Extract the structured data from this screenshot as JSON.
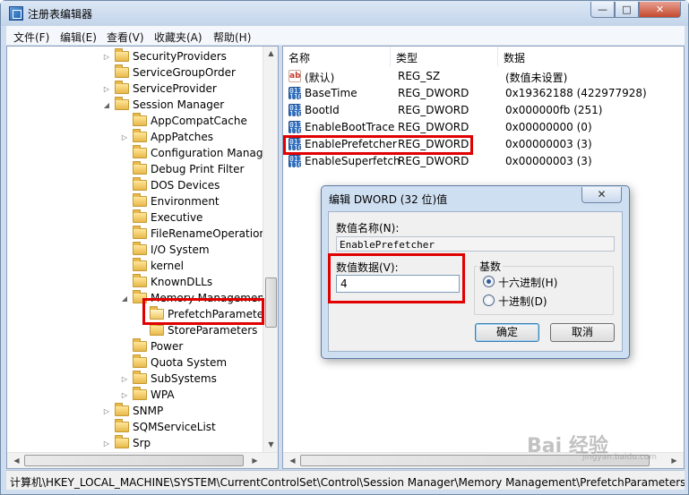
{
  "window": {
    "title": "注册表编辑器"
  },
  "window_buttons": {
    "min": "—",
    "max": "□",
    "close": "✕"
  },
  "menu": [
    "文件(F)",
    "编辑(E)",
    "查看(V)",
    "收藏夹(A)",
    "帮助(H)"
  ],
  "tree": [
    {
      "label": "SecurityProviders",
      "level": 1,
      "expander": "▷"
    },
    {
      "label": "ServiceGroupOrder",
      "level": 1,
      "expander": ""
    },
    {
      "label": "ServiceProvider",
      "level": 1,
      "expander": "▷"
    },
    {
      "label": "Session Manager",
      "level": 1,
      "expander": "◢"
    },
    {
      "label": "AppCompatCache",
      "level": 2,
      "expander": ""
    },
    {
      "label": "AppPatches",
      "level": 2,
      "expander": "▷"
    },
    {
      "label": "Configuration Manager",
      "level": 2,
      "expander": ""
    },
    {
      "label": "Debug Print Filter",
      "level": 2,
      "expander": ""
    },
    {
      "label": "DOS Devices",
      "level": 2,
      "expander": ""
    },
    {
      "label": "Environment",
      "level": 2,
      "expander": ""
    },
    {
      "label": "Executive",
      "level": 2,
      "expander": ""
    },
    {
      "label": "FileRenameOperations",
      "level": 2,
      "expander": ""
    },
    {
      "label": "I/O System",
      "level": 2,
      "expander": ""
    },
    {
      "label": "kernel",
      "level": 2,
      "expander": ""
    },
    {
      "label": "KnownDLLs",
      "level": 2,
      "expander": ""
    },
    {
      "label": "Memory Management",
      "level": 2,
      "expander": "◢"
    },
    {
      "label": "PrefetchParameters",
      "level": 3,
      "expander": "",
      "selected": true
    },
    {
      "label": "StoreParameters",
      "level": 3,
      "expander": ""
    },
    {
      "label": "Power",
      "level": 2,
      "expander": ""
    },
    {
      "label": "Quota System",
      "level": 2,
      "expander": ""
    },
    {
      "label": "SubSystems",
      "level": 2,
      "expander": "▷"
    },
    {
      "label": "WPA",
      "level": 2,
      "expander": "▷"
    },
    {
      "label": "SNMP",
      "level": 1,
      "expander": "▷"
    },
    {
      "label": "SQMServiceList",
      "level": 1,
      "expander": ""
    },
    {
      "label": "Srp",
      "level": 1,
      "expander": "▷"
    }
  ],
  "list": {
    "columns": [
      "名称",
      "类型",
      "数据"
    ],
    "rows": [
      {
        "icon": "string-value-icon",
        "glyph": "ab",
        "name": "(默认)",
        "type": "REG_SZ",
        "data": "(数值未设置)"
      },
      {
        "icon": "dword-value-icon",
        "glyph": "011\n110",
        "name": "BaseTime",
        "type": "REG_DWORD",
        "data": "0x19362188 (422977928)"
      },
      {
        "icon": "dword-value-icon",
        "glyph": "011\n110",
        "name": "BootId",
        "type": "REG_DWORD",
        "data": "0x000000fb (251)"
      },
      {
        "icon": "dword-value-icon",
        "glyph": "011\n110",
        "name": "EnableBootTrace",
        "type": "REG_DWORD",
        "data": "0x00000000 (0)"
      },
      {
        "icon": "dword-value-icon",
        "glyph": "011\n110",
        "name": "EnablePrefetcher",
        "type": "REG_DWORD",
        "data": "0x00000003 (3)"
      },
      {
        "icon": "dword-value-icon",
        "glyph": "011\n110",
        "name": "EnableSuperfetch",
        "type": "REG_DWORD",
        "data": "0x00000003 (3)"
      }
    ]
  },
  "dialog": {
    "title": "编辑 DWORD (32 位)值",
    "close": "✕",
    "name_label": "数值名称(N):",
    "name_value": "EnablePrefetcher",
    "data_label": "数值数据(V):",
    "data_value": "4",
    "base_label": "基数",
    "hex_label": "十六进制(H)",
    "dec_label": "十进制(D)",
    "ok": "确定",
    "cancel": "取消"
  },
  "status_path": "计算机\\HKEY_LOCAL_MACHINE\\SYSTEM\\CurrentControlSet\\Control\\Session Manager\\Memory Management\\PrefetchParameters",
  "watermark": {
    "main": "Bai 经验",
    "sub": "jingyan.baidu.com"
  },
  "colors": {
    "highlight": "#e00000",
    "title_bg": "#cfddee"
  }
}
